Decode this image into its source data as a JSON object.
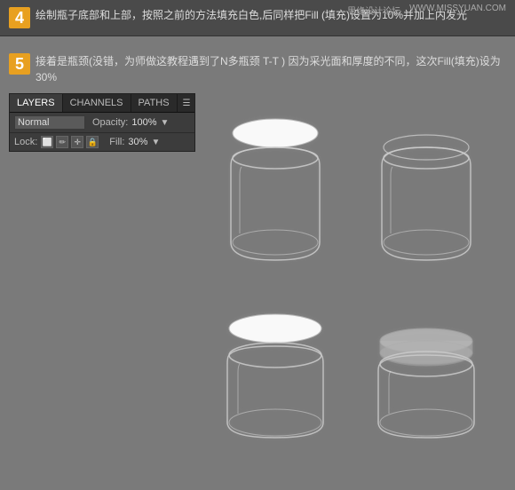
{
  "watermark": {
    "left": "思缘设计论坛",
    "right": "WWW.MISSYUAN.COM"
  },
  "step4": {
    "number": "4",
    "text": "绘制瓶子底部和上部，按照之前的方法填充白色,后同样把Fill\n(填充)设置为10%并加上内发光"
  },
  "step5": {
    "number": "5",
    "text": "接着是瓶颈(没错，为师做这教程遇到了N多瓶颈 T-T )\n因为采光面和厚度的不同，这次Fill(填充)设为30%"
  },
  "panel": {
    "tabs": {
      "layers": "LAYERS",
      "channels": "CHANNELS",
      "paths": "PATHS"
    },
    "active_tab": "LAYERS",
    "blend_mode": "Normal",
    "opacity_label": "Opacity:",
    "opacity_value": "100%",
    "lock_label": "Lock:",
    "fill_label": "Fill:",
    "fill_value": "30%"
  }
}
